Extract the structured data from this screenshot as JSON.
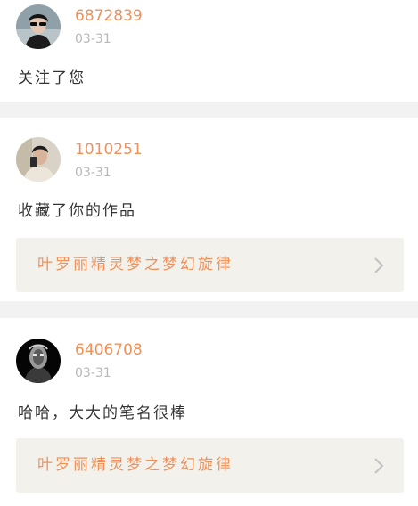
{
  "notifications": [
    {
      "username": "6872839",
      "date": "03-31",
      "message": "关注了您",
      "avatar_icon": "user-avatar-sunglasses"
    },
    {
      "username": "1010251",
      "date": "03-31",
      "message": "收藏了你的作品",
      "work_title": "叶罗丽精灵梦之梦幻旋律",
      "avatar_icon": "user-avatar-selfie"
    },
    {
      "username": "6406708",
      "date": "03-31",
      "message": "哈哈，大大的笔名很棒",
      "work_title": "叶罗丽精灵梦之梦幻旋律",
      "avatar_icon": "user-avatar-dark-figure"
    }
  ],
  "colors": {
    "username": "#f0915a",
    "date": "#b8b8b8",
    "message": "#333333",
    "work_link_bg": "#f2f1ec",
    "page_bg": "#f2f2f2"
  },
  "icons": {
    "chevron": "chevron-right-icon"
  }
}
